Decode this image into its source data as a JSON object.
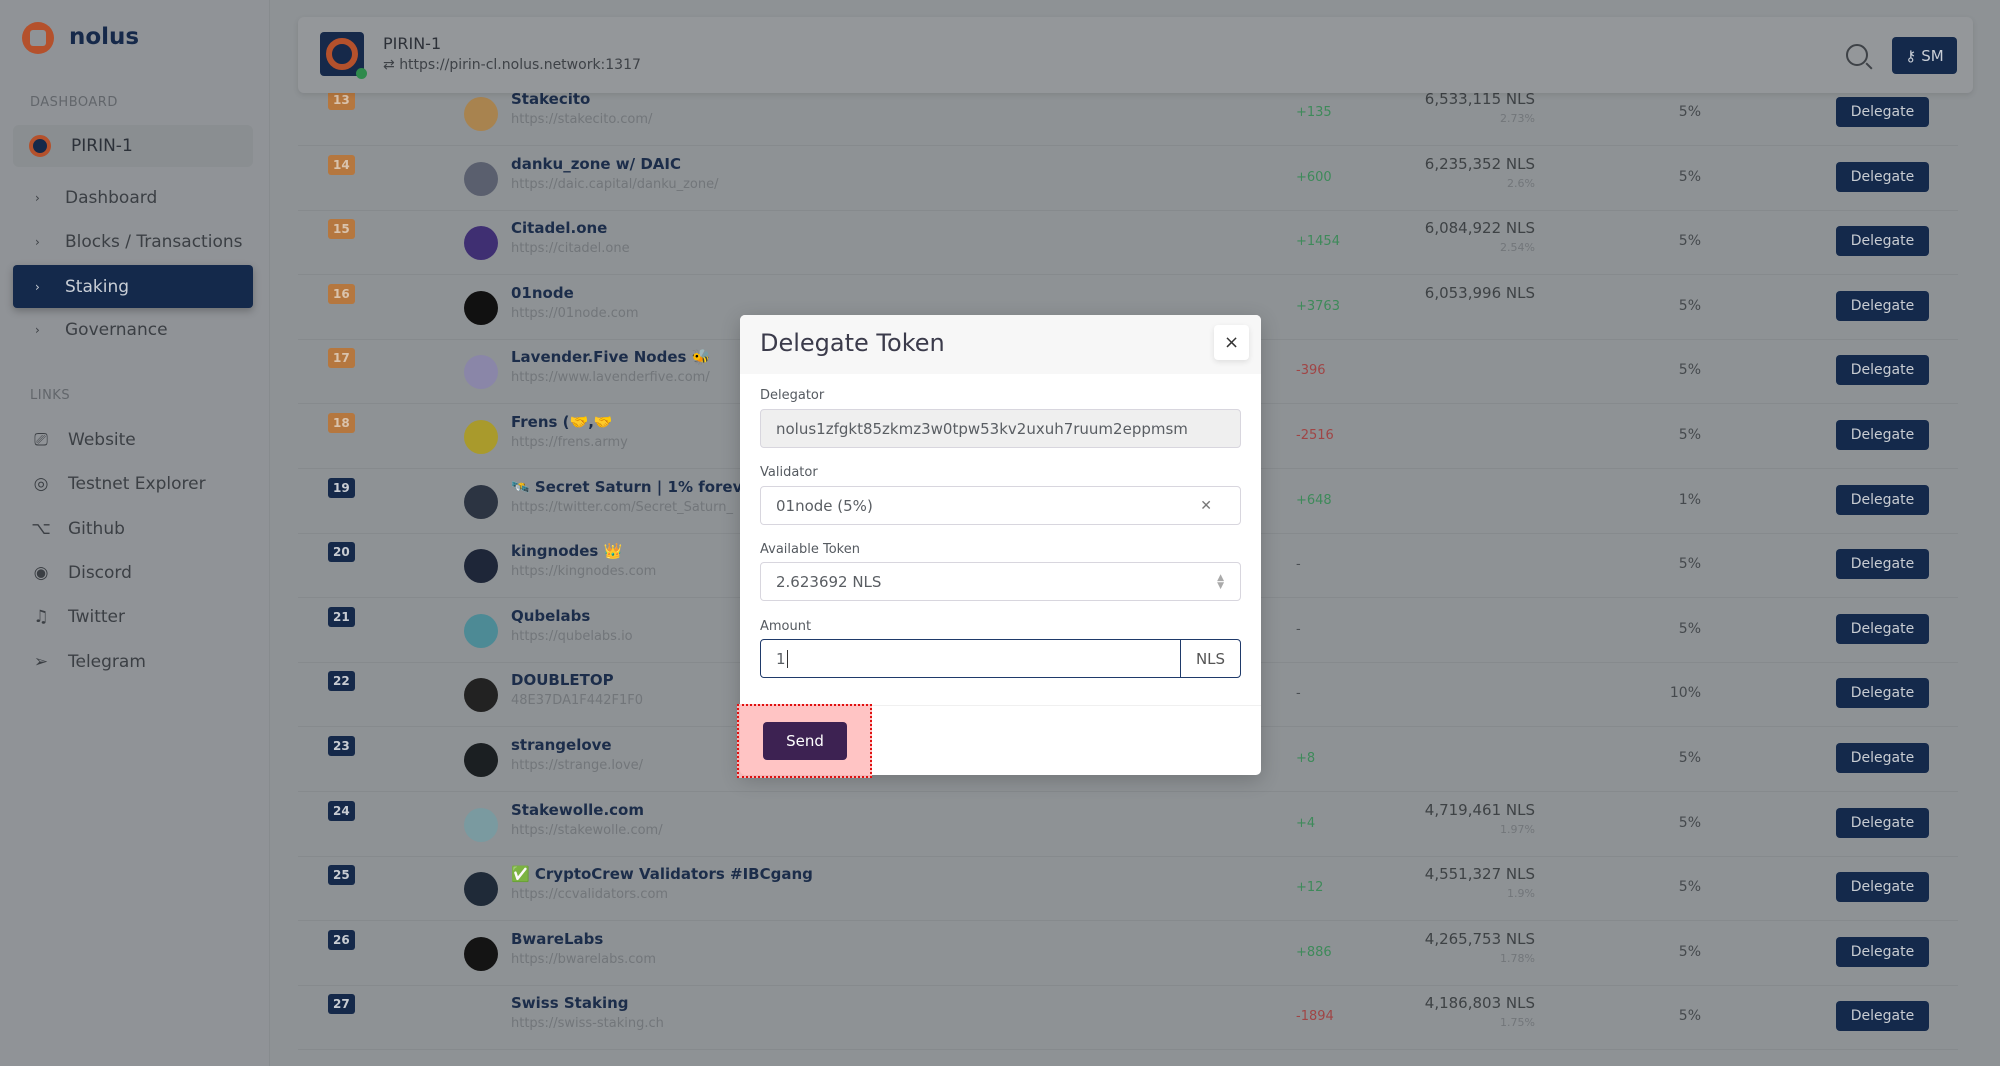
{
  "sidebar": {
    "brand": "nolus",
    "dashboard_label": "DASHBOARD",
    "chain": "PIRIN-1",
    "nav": [
      {
        "label": "Dashboard",
        "active": false
      },
      {
        "label": "Blocks / Transactions",
        "active": false
      },
      {
        "label": "Staking",
        "active": true
      },
      {
        "label": "Governance",
        "active": false
      }
    ],
    "links_label": "LINKS",
    "links": [
      {
        "label": "Website",
        "icon": "cast-icon"
      },
      {
        "label": "Testnet Explorer",
        "icon": "compass-icon"
      },
      {
        "label": "Github",
        "icon": "github-icon"
      },
      {
        "label": "Discord",
        "icon": "eye-icon"
      },
      {
        "label": "Twitter",
        "icon": "twitter-icon"
      },
      {
        "label": "Telegram",
        "icon": "send-icon"
      }
    ]
  },
  "header": {
    "chain": "PIRIN-1",
    "endpoint": "https://pirin-cl.nolus.network:1317",
    "wallet_label": "SM"
  },
  "validators": [
    {
      "rank": "13",
      "name": "Stakecito",
      "url": "https://stakecito.com/",
      "power": "6,533,115 NLS",
      "share": "2.73%",
      "change": "+135",
      "commission": "5%",
      "avatar": "#a8834f"
    },
    {
      "rank": "14",
      "name": "danku_zone w/ DAIC",
      "url": "https://daic.capital/danku_zone/",
      "power": "6,235,352 NLS",
      "share": "2.6%",
      "change": "+600",
      "commission": "5%",
      "avatar": "#5a5f6e"
    },
    {
      "rank": "15",
      "name": "Citadel.one",
      "url": "https://citadel.one",
      "power": "6,084,922 NLS",
      "share": "2.54%",
      "change": "+1454",
      "commission": "5%",
      "avatar": "#3f2f72"
    },
    {
      "rank": "16",
      "name": "01node",
      "url": "https://01node.com",
      "power": "6,053,996 NLS",
      "share": "",
      "change": "+3763",
      "commission": "5%",
      "avatar": "#111111"
    },
    {
      "rank": "17",
      "name": "Lavender.Five Nodes 🐝",
      "url": "https://www.lavenderfive.com/",
      "power": "",
      "share": "",
      "change": "-396",
      "commission": "5%",
      "avatar": "#8a86a8"
    },
    {
      "rank": "18",
      "name": "Frens (🤝,🤝",
      "url": "https://frens.army",
      "power": "",
      "share": "",
      "change": "-2516",
      "commission": "5%",
      "avatar": "#a99a2c"
    },
    {
      "rank": "19",
      "name": "🛰️ Secret Saturn | 1% forever",
      "url": "https://twitter.com/Secret_Saturn_",
      "power": "",
      "share": "",
      "change": "+648",
      "commission": "1%",
      "avatar": "#2c3442"
    },
    {
      "rank": "20",
      "name": "kingnodes 👑",
      "url": "https://kingnodes.com",
      "power": "",
      "share": "",
      "change": "-",
      "commission": "5%",
      "avatar": "#1e2638"
    },
    {
      "rank": "21",
      "name": "Qubelabs",
      "url": "https://qubelabs.io",
      "power": "",
      "share": "",
      "change": "-",
      "commission": "5%",
      "avatar": "#4d8a95"
    },
    {
      "rank": "22",
      "name": "DOUBLETOP",
      "url": "48E37DA1F442F1F0",
      "power": "",
      "share": "",
      "change": "-",
      "commission": "10%",
      "avatar": "#222222"
    },
    {
      "rank": "23",
      "name": "strangelove",
      "url": "https://strange.love/",
      "power": "",
      "share": "",
      "change": "+8",
      "commission": "5%",
      "avatar": "#1b1f22"
    },
    {
      "rank": "24",
      "name": "Stakewolle.com",
      "url": "https://stakewolle.com/",
      "power": "4,719,461 NLS",
      "share": "1.97%",
      "change": "+4",
      "commission": "5%",
      "avatar": "#7a9aa0"
    },
    {
      "rank": "25",
      "name": "✅ CryptoCrew Validators #IBCgang",
      "url": "https://ccvalidators.com",
      "power": "4,551,327 NLS",
      "share": "1.9%",
      "change": "+12",
      "commission": "5%",
      "avatar": "#1f2a38"
    },
    {
      "rank": "26",
      "name": "BwareLabs",
      "url": "https://bwarelabs.com",
      "power": "4,265,753 NLS",
      "share": "1.78%",
      "change": "+886",
      "commission": "5%",
      "avatar": "#141414"
    },
    {
      "rank": "27",
      "name": "Swiss Staking",
      "url": "https://swiss-staking.ch",
      "power": "4,186,803 NLS",
      "share": "1.75%",
      "change": "-1894",
      "commission": "5%",
      "avatar": "#8e9295"
    }
  ],
  "delegate_label": "Delegate",
  "modal": {
    "title": "Delegate Token",
    "close": "×",
    "delegator_label": "Delegator",
    "delegator": "nolus1zfgkt85zkmz3w0tpw53kv2uxuh7ruum2eppmsm",
    "validator_label": "Validator",
    "validator": "01node (5%)",
    "available_label": "Available Token",
    "available": "2.623692 NLS",
    "amount_label": "Amount",
    "amount": "1",
    "amount_unit": "NLS",
    "send": "Send"
  }
}
